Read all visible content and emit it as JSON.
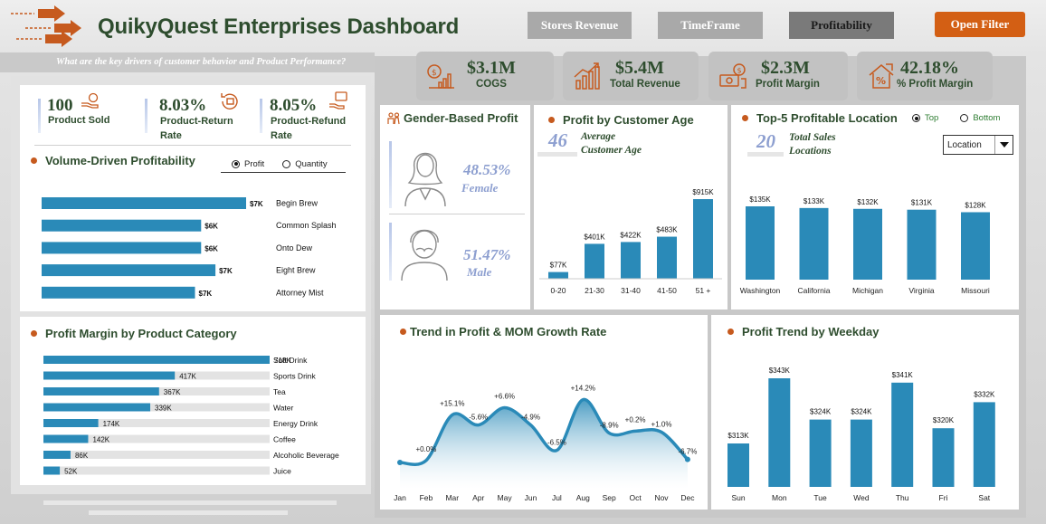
{
  "header": {
    "title": "QuikyQuest Enterprises Dashboard",
    "subtitle": "What are the key drivers of customer behavior and Product Performance?",
    "nav": {
      "stores_revenue": "Stores Revenue",
      "timeframe": "TimeFrame",
      "profitability": "Profitability",
      "open_filter": "Open Filter"
    }
  },
  "colors": {
    "accent_orange": "#d35f14",
    "bar_blue": "#2a8ab8",
    "title_green": "#2e4d2e",
    "pale_blue": "#8d9fd0"
  },
  "kpis": [
    {
      "value": "$3.1M",
      "label": "COGS",
      "icon": "money-bag-chart-icon"
    },
    {
      "value": "$5.4M",
      "label": "Total Revenue",
      "icon": "growth-chart-icon"
    },
    {
      "value": "$2.3M",
      "label": "Profit Margin",
      "icon": "cash-stack-icon"
    },
    {
      "value": "42.18%",
      "label": "% Profit Margin",
      "icon": "percent-house-icon"
    }
  ],
  "product_stats": [
    {
      "value": "100",
      "label": "Product Sold",
      "icon": "hand-coin-icon"
    },
    {
      "value": "8.03%",
      "label": "Product-Return Rate",
      "icon": "return-box-icon"
    },
    {
      "value": "8.05%",
      "label": "Product-Refund Rate",
      "icon": "refund-hand-icon"
    }
  ],
  "volume_profitability": {
    "title": "Volume-Driven Profitability",
    "radio": {
      "profit": "Profit",
      "quantity": "Quantity",
      "selected": "Profit"
    },
    "chart_data": {
      "type": "bar",
      "orientation": "horizontal",
      "categories": [
        "Begin Brew",
        "Common Splash",
        "Onto Dew",
        "Eight Brew",
        "Attorney Mist"
      ],
      "values": [
        7,
        6,
        6,
        7,
        7
      ],
      "value_labels": [
        "$7K",
        "$6K",
        "$6K",
        "$7K",
        "$7K"
      ],
      "bar_fractions": [
        1.0,
        0.78,
        0.78,
        0.85,
        0.75
      ]
    }
  },
  "category_margin": {
    "title": "Profit Margin by Product Category",
    "chart_data": {
      "type": "bar",
      "orientation": "horizontal",
      "categories": [
        "Soft Drink",
        "Sports Drink",
        "Tea",
        "Water",
        "Energy Drink",
        "Coffee",
        "Alcoholic Beverage",
        "Juice"
      ],
      "values": [
        718,
        417,
        367,
        339,
        174,
        142,
        86,
        52
      ],
      "value_labels": [
        "718K",
        "417K",
        "367K",
        "339K",
        "174K",
        "142K",
        "86K",
        "52K"
      ],
      "max": 718
    }
  },
  "gender": {
    "title": "Gender-Based Profit",
    "female_pct": "48.53%",
    "female_label": "Female",
    "male_pct": "51.47%",
    "male_label": "Male"
  },
  "age": {
    "title": "Profit by Customer Age",
    "avg_value": "46",
    "avg_label_1": "Average",
    "avg_label_2": "Customer Age",
    "chart_data": {
      "type": "bar",
      "categories": [
        "0-20",
        "21-30",
        "31-40",
        "41-50",
        "51 +"
      ],
      "values": [
        77,
        401,
        422,
        483,
        915
      ],
      "value_labels": [
        "$77K",
        "$401K",
        "$422K",
        "$483K",
        "$915K"
      ],
      "ylim": [
        0,
        915
      ]
    }
  },
  "locations": {
    "title": "Top-5 Profitable Location",
    "radio": {
      "top": "Top",
      "bottom": "Bottom",
      "selected": "Top"
    },
    "stat_value": "20",
    "stat_label_1": "Total Sales",
    "stat_label_2": "Locations",
    "dropdown_value": "Location",
    "chart_data": {
      "type": "bar",
      "categories": [
        "Washington",
        "California",
        "Michigan",
        "Virginia",
        "Missouri"
      ],
      "values": [
        135,
        133,
        132,
        131,
        128
      ],
      "value_labels": [
        "$135K",
        "$133K",
        "$132K",
        "$131K",
        "$128K"
      ]
    }
  },
  "trend": {
    "title": "Trend in Profit & MOM Growth Rate",
    "chart_data": {
      "type": "area",
      "x": [
        "Jan",
        "Feb",
        "Mar",
        "Apr",
        "May",
        "Jun",
        "Jul",
        "Aug",
        "Sep",
        "Oct",
        "Nov",
        "Dec"
      ],
      "profit_shape": [
        0.08,
        0.1,
        0.55,
        0.45,
        0.62,
        0.45,
        0.2,
        0.7,
        0.37,
        0.39,
        0.38,
        0.11
      ],
      "growth_labels": [
        "",
        "+0.0%",
        "+15.1%",
        "-5.6%",
        "+6.6%",
        "-4.9%",
        "-6.5%",
        "+14.2%",
        "-8.9%",
        "+0.2%",
        "+1.0%",
        "-6.7%"
      ]
    }
  },
  "weekday": {
    "title": "Profit Trend by Weekday",
    "chart_data": {
      "type": "bar",
      "categories": [
        "Sun",
        "Mon",
        "Tue",
        "Wed",
        "Thu",
        "Fri",
        "Sat"
      ],
      "values": [
        313,
        343,
        324,
        324,
        341,
        320,
        332
      ],
      "value_labels": [
        "$313K",
        "$343K",
        "$324K",
        "$324K",
        "$341K",
        "$320K",
        "$332K"
      ]
    }
  }
}
